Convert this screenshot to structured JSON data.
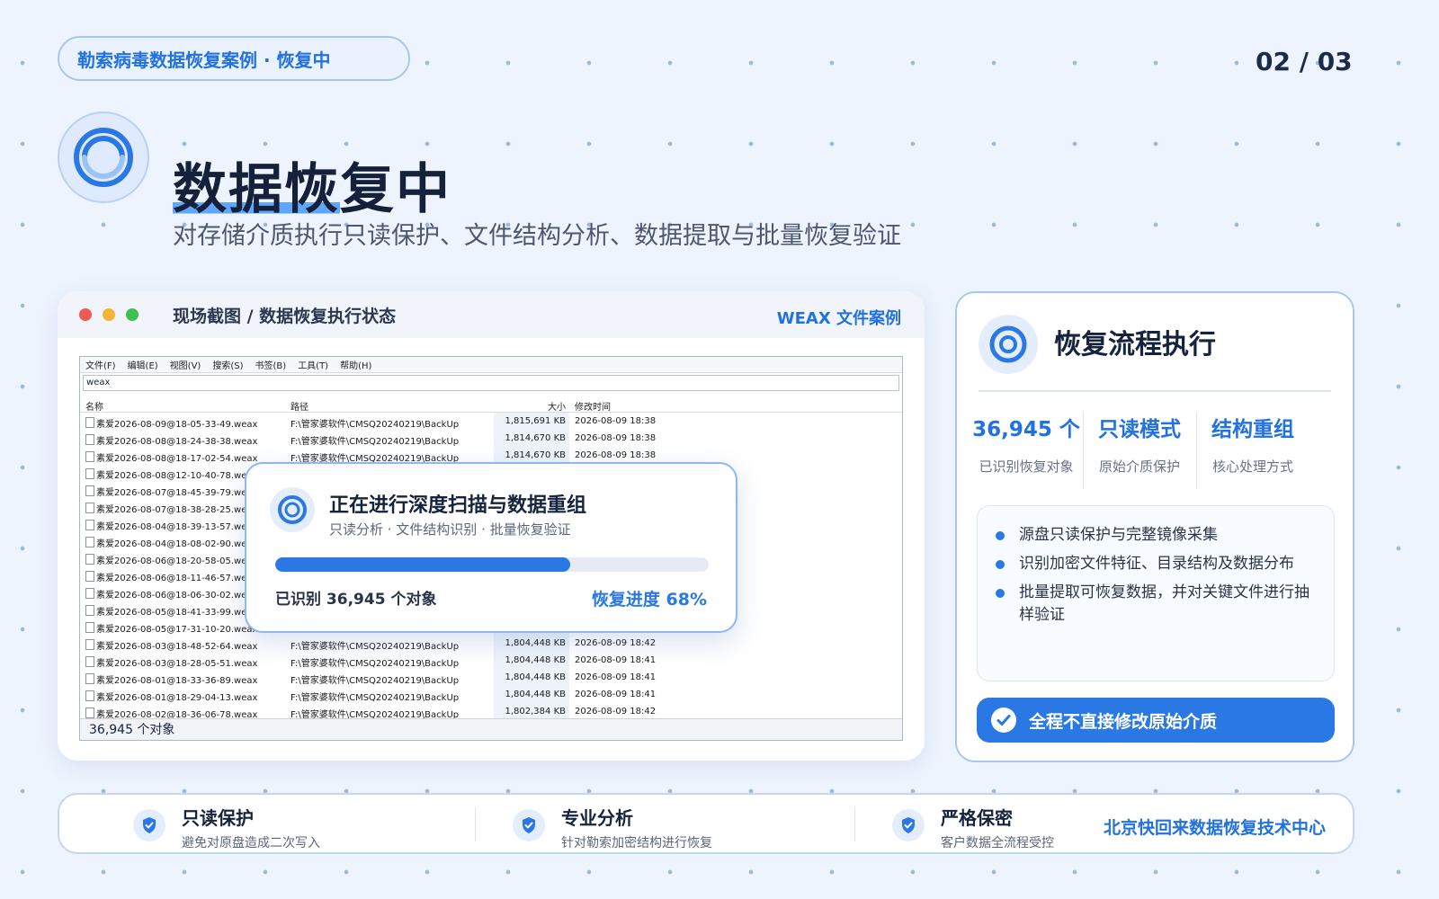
{
  "header": {
    "badge": "勒索病毒数据恢复案例 · 恢复中",
    "page_indicator": "02 / 03",
    "title_highlight": "数据恢",
    "title_rest": "复中",
    "subtitle": "对存储介质执行只读保护、文件结构分析、数据提取与批量恢复验证"
  },
  "screenshot_card": {
    "title": "现场截图 / 数据恢复执行状态",
    "tag": "WEAX 文件案例",
    "window": {
      "menu": [
        "文件(F)",
        "编辑(E)",
        "视图(V)",
        "搜索(S)",
        "书签(B)",
        "工具(T)",
        "帮助(H)"
      ],
      "search_value": "weax",
      "columns": [
        "名称",
        "路径",
        "大小",
        "修改时间"
      ],
      "rows": [
        [
          "素爱2026-08-09@18-05-33-49.weax",
          "F:\\管家婆软件\\CMSQ20240219\\BackUp",
          "1,815,691 KB",
          "2026-08-09 18:38"
        ],
        [
          "素爱2026-08-08@18-24-38-38.weax",
          "F:\\管家婆软件\\CMSQ20240219\\BackUp",
          "1,814,670 KB",
          "2026-08-09 18:38"
        ],
        [
          "素爱2026-08-08@18-17-02-54.weax",
          "F:\\管家婆软件\\CMSQ20240219\\BackUp",
          "1,814,670 KB",
          "2026-08-09 18:38"
        ],
        [
          "素爱2026-08-08@12-10-40-78.weax",
          "",
          "",
          ""
        ],
        [
          "素爱2026-08-07@18-45-39-79.weax",
          "",
          "",
          ""
        ],
        [
          "素爱2026-08-07@18-38-28-25.weax",
          "",
          "",
          ""
        ],
        [
          "素爱2026-08-04@18-39-13-57.weax",
          "",
          "",
          ""
        ],
        [
          "素爱2026-08-04@18-08-02-90.weax",
          "",
          "",
          ""
        ],
        [
          "素爱2026-08-06@18-20-58-05.weax",
          "",
          "",
          ""
        ],
        [
          "素爱2026-08-06@18-11-46-57.weax",
          "",
          "",
          ""
        ],
        [
          "素爱2026-08-06@18-06-30-02.weax",
          "",
          "",
          ""
        ],
        [
          "素爱2026-08-05@18-41-33-99.weax",
          "",
          "",
          ""
        ],
        [
          "素爱2026-08-05@17-31-10-20.weax",
          "",
          "",
          ""
        ],
        [
          "素爱2026-08-03@18-48-52-64.weax",
          "F:\\管家婆软件\\CMSQ20240219\\BackUp",
          "1,804,448 KB",
          "2026-08-09 18:42"
        ],
        [
          "素爱2026-08-03@18-28-05-51.weax",
          "F:\\管家婆软件\\CMSQ20240219\\BackUp",
          "1,804,448 KB",
          "2026-08-09 18:41"
        ],
        [
          "素爱2026-08-01@18-33-36-89.weax",
          "F:\\管家婆软件\\CMSQ20240219\\BackUp",
          "1,804,448 KB",
          "2026-08-09 18:41"
        ],
        [
          "素爱2026-08-01@18-29-04-13.weax",
          "F:\\管家婆软件\\CMSQ20240219\\BackUp",
          "1,804,448 KB",
          "2026-08-09 18:41"
        ],
        [
          "素爱2026-08-02@18-36-06-78.weax",
          "F:\\管家婆软件\\CMSQ20240219\\BackUp",
          "1,802,384 KB",
          "2026-08-09 18:42"
        ]
      ],
      "status_text": "36,945 个对象"
    },
    "overlay": {
      "title": "正在进行深度扫描与数据重组",
      "subtitle": "只读分析 · 文件结构识别 · 批量恢复验证",
      "progress": 0.68,
      "count_text": "已识别 36,945 个对象",
      "progress_text": "恢复进度 68%"
    }
  },
  "side_panel": {
    "title": "恢复流程执行",
    "stats": [
      {
        "value": "36,945 个",
        "label": "已识别恢复对象"
      },
      {
        "value": "只读模式",
        "label": "原始介质保护"
      },
      {
        "value": "结构重组",
        "label": "核心处理方式"
      }
    ],
    "bullets": [
      "源盘只读保护与完整镜像采集",
      "识别加密文件特征、目录结构及数据分布",
      "批量提取可恢复数据，并对关键文件进行抽样验证"
    ],
    "cta": "全程不直接修改原始介质"
  },
  "footer": {
    "features": [
      {
        "title": "只读保护",
        "desc": "避免对原盘造成二次写入"
      },
      {
        "title": "专业分析",
        "desc": "针对勒索加密结构进行恢复"
      },
      {
        "title": "严格保密",
        "desc": "客户数据全流程受控"
      }
    ],
    "org": "北京快回来数据恢复技术中心"
  },
  "colors": {
    "accent": "#2a78e4",
    "traffic_red": "#ee5b52",
    "traffic_yellow": "#f3b534",
    "traffic_green": "#3fbf4f"
  }
}
